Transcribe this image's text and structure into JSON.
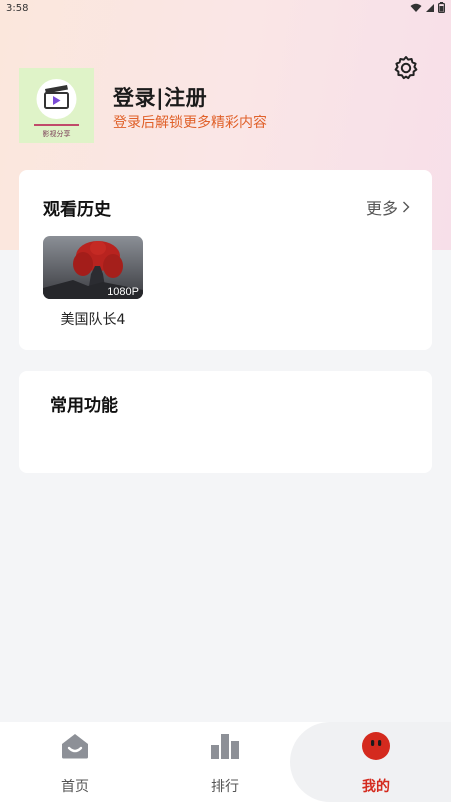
{
  "status_bar": {
    "time": "3:58"
  },
  "profile": {
    "avatar_caption": "影视分享",
    "title": "登录|注册",
    "subtitle": "登录后解锁更多精彩内容"
  },
  "history": {
    "title": "观看历史",
    "more_label": "更多",
    "items": [
      {
        "title": "美国队长4",
        "badge": "1080P"
      }
    ]
  },
  "functions": {
    "title": "常用功能"
  },
  "tabbar": {
    "tabs": [
      {
        "label": "首页",
        "icon": "home-icon",
        "active": false
      },
      {
        "label": "排行",
        "icon": "bar-chart-icon",
        "active": false
      },
      {
        "label": "我的",
        "icon": "profile-face-icon",
        "active": true
      }
    ]
  },
  "colors": {
    "accent": "#d42a1e",
    "subtitle": "#e0612a",
    "avatar_bg": "#dff3c8"
  }
}
